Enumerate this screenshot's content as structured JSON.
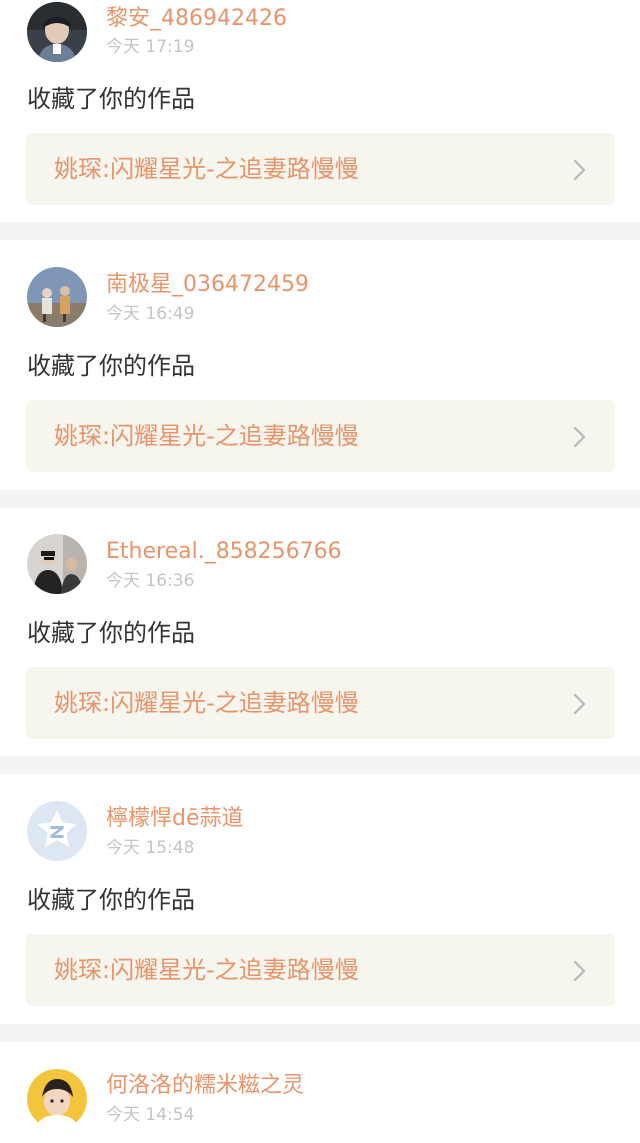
{
  "notifications": [
    {
      "username": "黎安_486942426",
      "time": "今天 17:19",
      "action": "收藏了你的作品",
      "work_title": "姚琛:闪耀星光-之追妻路慢慢",
      "avatar_icon": "dark-portrait-avatar"
    },
    {
      "username": "南极星_036472459",
      "time": "今天 16:49",
      "action": "收藏了你的作品",
      "work_title": "姚琛:闪耀星光-之追妻路慢慢",
      "avatar_icon": "outdoor-group-avatar"
    },
    {
      "username": "Ethereal._858256766",
      "time": "今天 16:36",
      "action": "收藏了你的作品",
      "work_title": "姚琛:闪耀星光-之追妻路慢慢",
      "avatar_icon": "two-people-avatar"
    },
    {
      "username": "檸檬悍dē蒜道",
      "time": "今天 15:48",
      "action": "收藏了你的作品",
      "work_title": "姚琛:闪耀星光-之追妻路慢慢",
      "avatar_icon": "default-star-avatar"
    },
    {
      "username": "何洛洛的糯米糍之灵",
      "time": "今天 14:54",
      "action": "",
      "work_title": "",
      "avatar_icon": "yellow-portrait-avatar"
    }
  ],
  "colors": {
    "accent": "#e8946a",
    "time": "#c4c4c4",
    "text": "#333333",
    "link_bg": "#f6f5ee",
    "separator": "#f3f3f3"
  }
}
